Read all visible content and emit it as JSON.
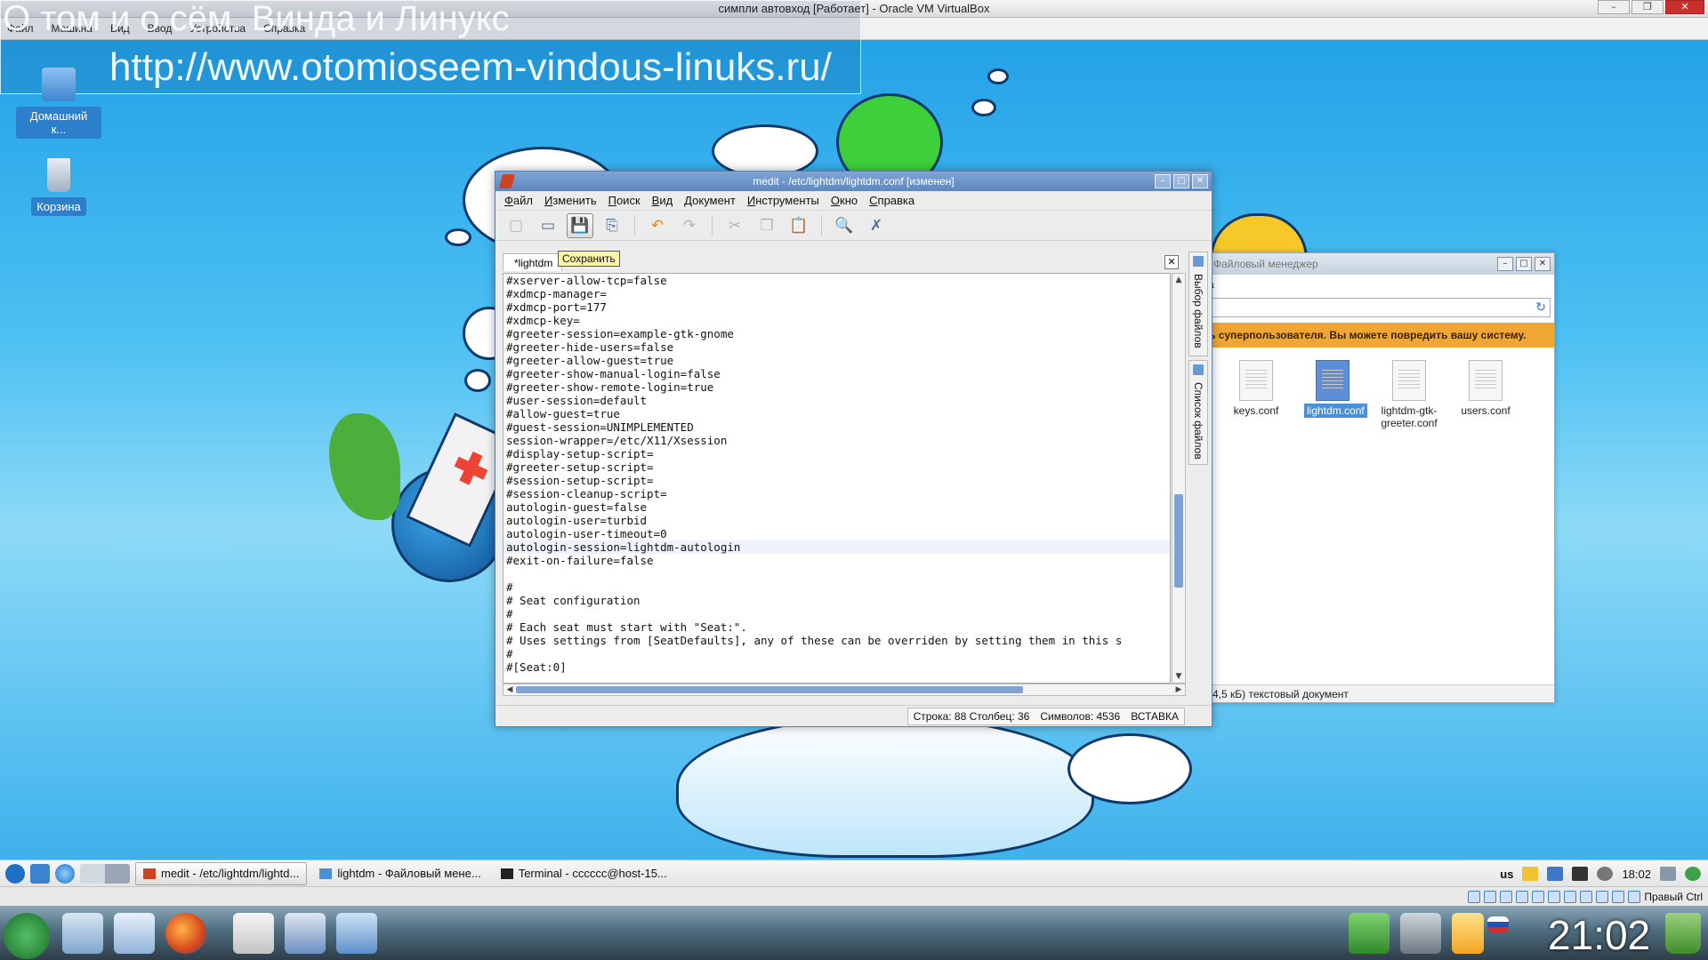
{
  "host": {
    "title": "симпли автовход [Работает] - Oracle VM VirtualBox",
    "menu": [
      "Файл",
      "Машина",
      "Вид",
      "Ввод",
      "Устройства",
      "Справка"
    ],
    "status_right": "Правый Ctrl"
  },
  "watermark": {
    "title": "О том и о сём. Винда и Линукс",
    "url": "http://www.otomioseem-vindous-linuks.ru/"
  },
  "desktop": {
    "icons": [
      {
        "label": "Домашний к...",
        "icon": "home-folder-icon"
      },
      {
        "label": "Корзина",
        "icon": "trash-icon"
      }
    ]
  },
  "editor": {
    "title": "medit - /etc/lightdm/lightdm.conf [изменен]",
    "menu": [
      "Файл",
      "Изменить",
      "Поиск",
      "Вид",
      "Документ",
      "Инструменты",
      "Окно",
      "Справка"
    ],
    "tooltip": "Сохранить",
    "tab_label": "*lightdm",
    "code": [
      "#xserver-allow-tcp=false",
      "#xdmcp-manager=",
      "#xdmcp-port=177",
      "#xdmcp-key=",
      "#greeter-session=example-gtk-gnome",
      "#greeter-hide-users=false",
      "#greeter-allow-guest=true",
      "#greeter-show-manual-login=false",
      "#greeter-show-remote-login=true",
      "#user-session=default",
      "#allow-guest=true",
      "#guest-session=UNIMPLEMENTED",
      "session-wrapper=/etc/X11/Xsession",
      "#display-setup-script=",
      "#greeter-setup-script=",
      "#session-setup-script=",
      "#session-cleanup-script=",
      "autologin-guest=false",
      "autologin-user=turbid",
      "autologin-user-timeout=0",
      "autologin-session=lightdm-autologin",
      "#exit-on-failure=false",
      "",
      "#",
      "# Seat configuration",
      "#",
      "# Each seat must start with \"Seat:\".",
      "# Uses settings from [SeatDefaults], any of these can be overriden by setting them in this s",
      "#",
      "#[Seat:0]"
    ],
    "side_tabs": [
      "Выбор файлов",
      "Список файлов"
    ],
    "status": {
      "position": "Строка: 88 Столбец: 36",
      "chars": "Символов: 4536",
      "mode": "ВСТАВКА"
    }
  },
  "filemanager": {
    "title": "Файловый менеджер",
    "menu_fragment": "а",
    "warning": "ь суперпользователя. Вы можете повредить вашу систему.",
    "files": [
      {
        "name": "keys.conf",
        "selected": false
      },
      {
        "name": "lightdm.conf",
        "selected": true
      },
      {
        "name": "lightdm-gtk-greeter.conf",
        "selected": false
      },
      {
        "name": "users.conf",
        "selected": false
      }
    ],
    "status": "(4,5 кБ) текстовый документ"
  },
  "taskbar": {
    "tasks": [
      {
        "label": "medit - /etc/lightdm/lightd...",
        "active": true
      },
      {
        "label": "lightdm - Файловый мене...",
        "active": false
      },
      {
        "label": "Terminal - cccccc@host-15...",
        "active": false
      }
    ],
    "layout": "us",
    "clock": "18:02"
  },
  "dock": {
    "clock": "21:02"
  },
  "colors": {
    "desktop_top": "#1e9ee6",
    "titlebar_blue": "#5f88c0",
    "warning_orange": "#f0a632",
    "selection_blue": "#4a90d9"
  }
}
